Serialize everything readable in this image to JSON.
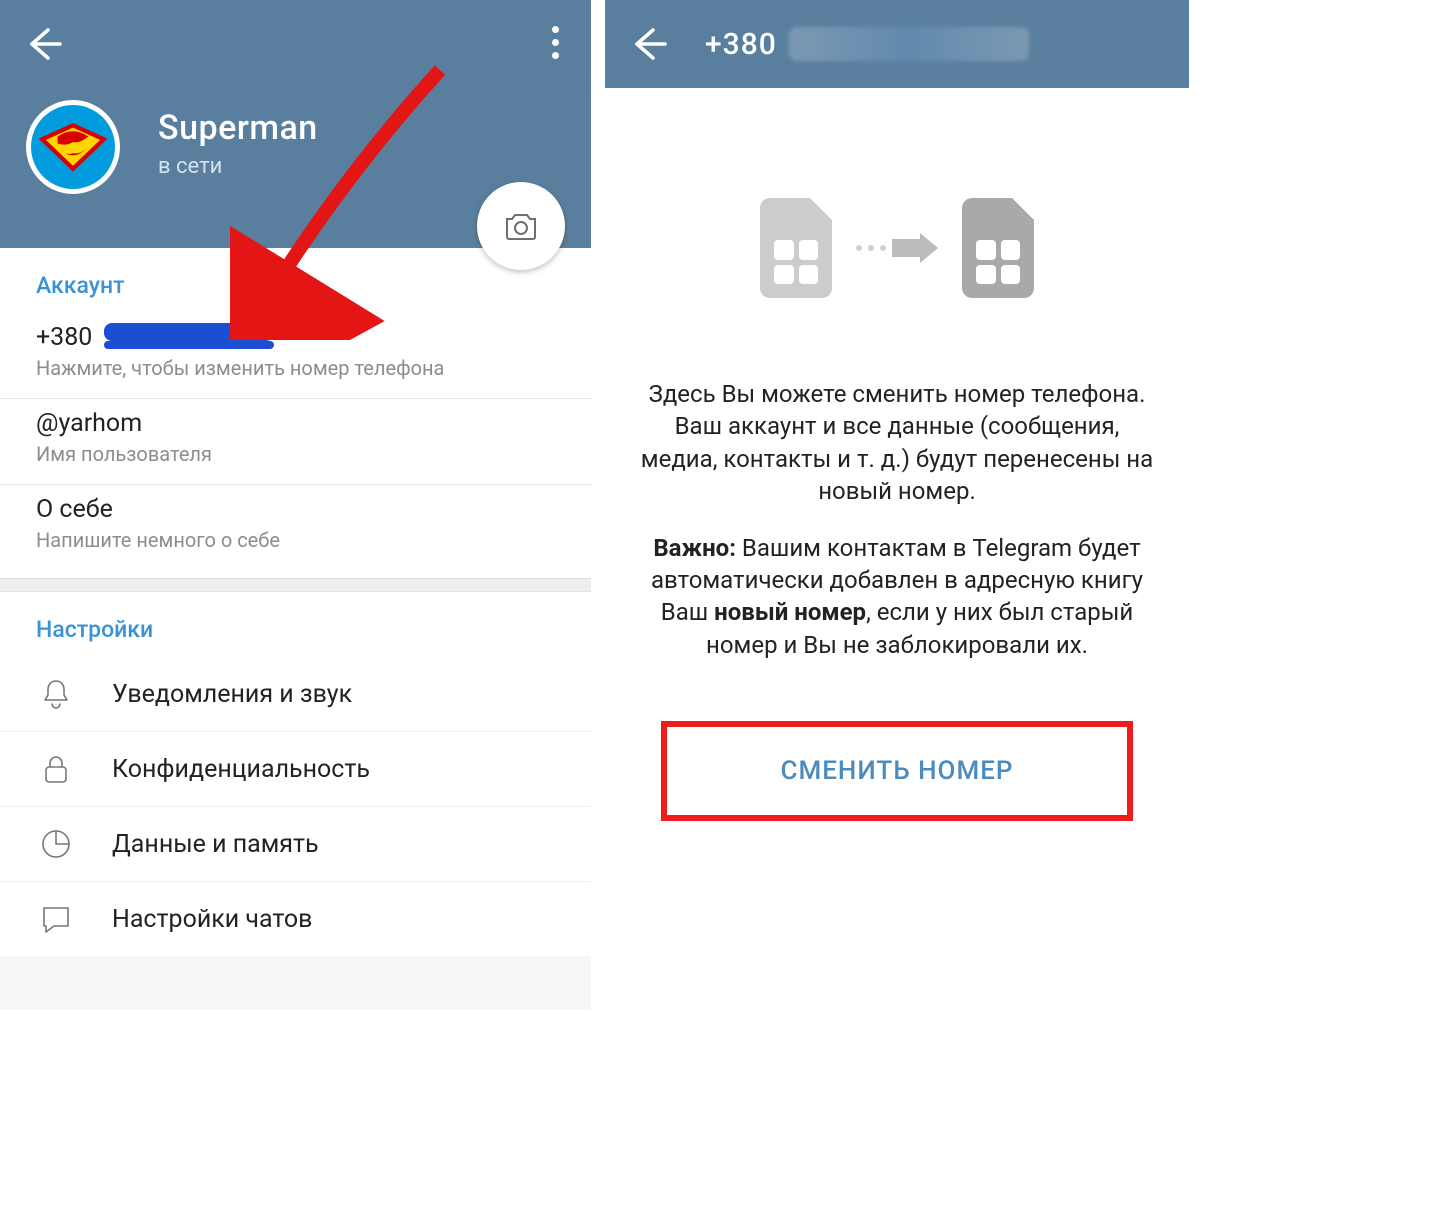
{
  "left": {
    "profile": {
      "display_name": "Superman",
      "status": "в сети"
    },
    "account": {
      "section_title": "Аккаунт",
      "phone_prefix": "+380",
      "phone_hint": "Нажмите, чтобы изменить номер телефона",
      "username": "@yarhom",
      "username_hint": "Имя пользователя",
      "about_label": "О себе",
      "about_hint": "Напишите немного о себе"
    },
    "settings": {
      "section_title": "Настройки",
      "items": [
        {
          "icon": "bell",
          "label": "Уведомления и звук"
        },
        {
          "icon": "lock",
          "label": "Конфиденциальность"
        },
        {
          "icon": "pie",
          "label": "Данные и память"
        },
        {
          "icon": "chat",
          "label": "Настройки чатов"
        }
      ]
    }
  },
  "right": {
    "title_prefix": "+380",
    "body": {
      "p1": "Здесь Вы можете сменить номер телефона. Ваш аккаунт и все данные (сообщения, медиа, контакты и т. д.) будут перенесены на новый номер.",
      "p2_bold": "Важно:",
      "p2_rest1": " Вашим контактам в Telegram будет автоматически добавлен в адресную книгу Ваш ",
      "p2_bold2": "новый номер",
      "p2_rest2": ", если у них был старый номер и Вы не заблокировали их."
    },
    "button": "СМЕНИТЬ НОМЕР"
  }
}
